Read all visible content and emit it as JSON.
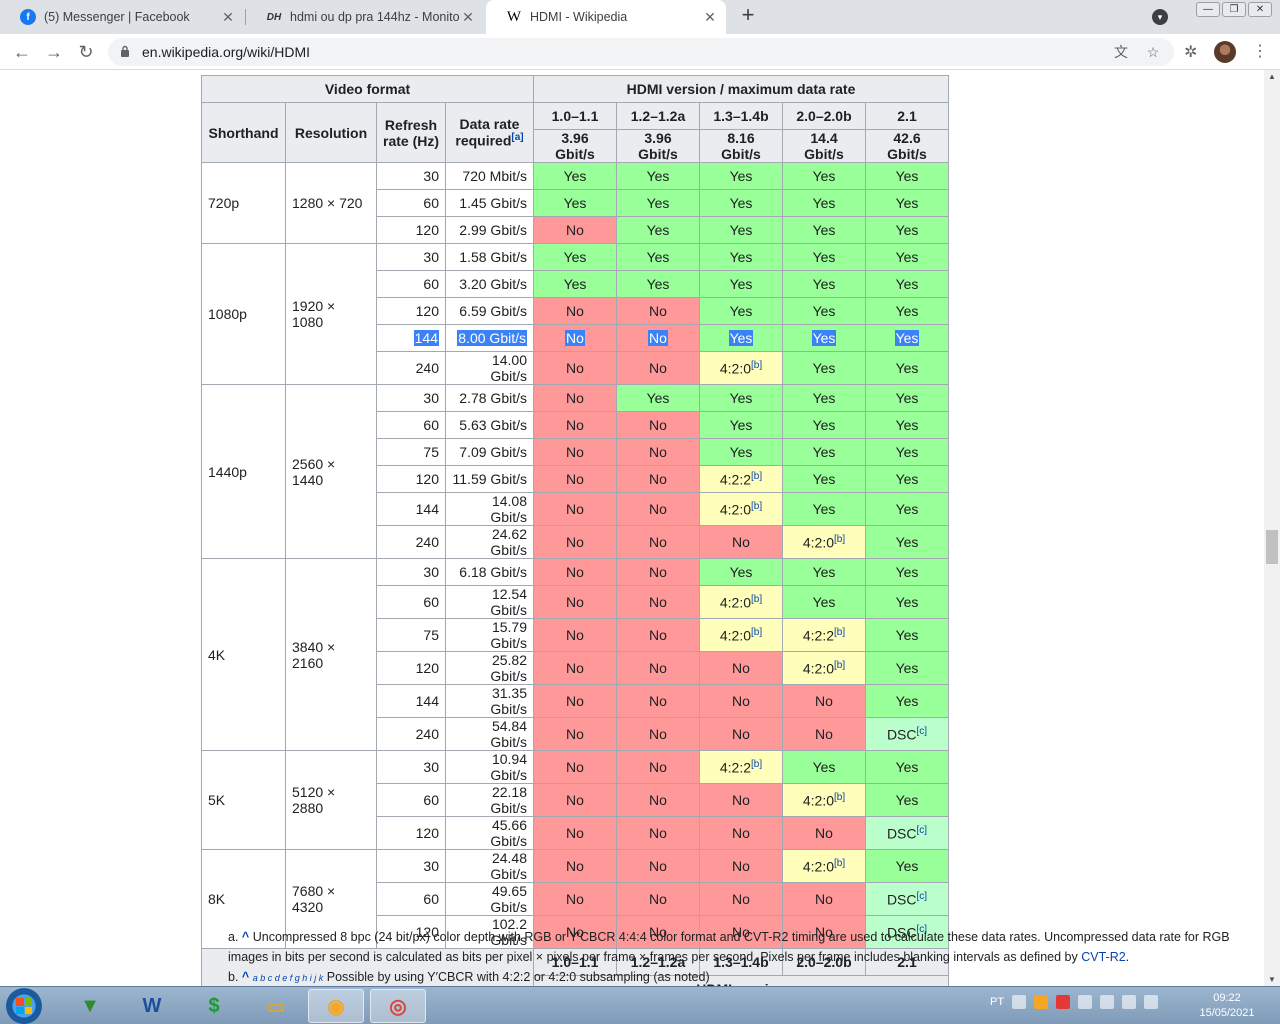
{
  "browser": {
    "tabs": [
      {
        "title": "(5) Messenger | Facebook",
        "favicon": "facebook-icon"
      },
      {
        "title": "hdmi ou dp pra 144hz - Monitores",
        "favicon": "dh-icon"
      },
      {
        "title": "HDMI - Wikipedia",
        "favicon": "wikipedia-icon"
      }
    ],
    "url": "en.wikipedia.org/wiki/HDMI"
  },
  "table": {
    "header": {
      "video_format": "Video format",
      "hdmi_version_rate": "HDMI version / maximum data rate",
      "shorthand": "Shorthand",
      "resolution": "Resolution",
      "refresh_rate": "Refresh rate (Hz)",
      "data_rate": "Data rate required",
      "data_rate_note": "[a]",
      "versions": [
        "1.0–1.1",
        "1.2–1.2a",
        "1.3–1.4b",
        "2.0–2.0b",
        "2.1"
      ],
      "max_rates": [
        "3.96 Gbit/s",
        "3.96 Gbit/s",
        "8.16 Gbit/s",
        "14.4 Gbit/s",
        "42.6 Gbit/s"
      ]
    },
    "groups": [
      {
        "shorthand": "720p",
        "resolution": "1280 × 720",
        "rows": [
          {
            "hz": "30",
            "rate": "720 Mbit/s",
            "cells": [
              "Yes",
              "Yes",
              "Yes",
              "Yes",
              "Yes"
            ]
          },
          {
            "hz": "60",
            "rate": "1.45 Gbit/s",
            "cells": [
              "Yes",
              "Yes",
              "Yes",
              "Yes",
              "Yes"
            ]
          },
          {
            "hz": "120",
            "rate": "2.99 Gbit/s",
            "cells": [
              "No",
              "Yes",
              "Yes",
              "Yes",
              "Yes"
            ]
          }
        ]
      },
      {
        "shorthand": "1080p",
        "resolution": "1920 × 1080",
        "rows": [
          {
            "hz": "30",
            "rate": "1.58 Gbit/s",
            "cells": [
              "Yes",
              "Yes",
              "Yes",
              "Yes",
              "Yes"
            ]
          },
          {
            "hz": "60",
            "rate": "3.20 Gbit/s",
            "cells": [
              "Yes",
              "Yes",
              "Yes",
              "Yes",
              "Yes"
            ]
          },
          {
            "hz": "120",
            "rate": "6.59 Gbit/s",
            "cells": [
              "No",
              "No",
              "Yes",
              "Yes",
              "Yes"
            ]
          },
          {
            "hz": "144",
            "rate": "8.00 Gbit/s",
            "cells": [
              "No",
              "No",
              "Yes",
              "Yes",
              "Yes"
            ],
            "selected": true
          },
          {
            "hz": "240",
            "rate": "14.00 Gbit/s",
            "cells": [
              "No",
              "No",
              "4:2:0",
              "Yes",
              "Yes"
            ]
          }
        ]
      },
      {
        "shorthand": "1440p",
        "resolution": "2560 × 1440",
        "rows": [
          {
            "hz": "30",
            "rate": "2.78 Gbit/s",
            "cells": [
              "No",
              "Yes",
              "Yes",
              "Yes",
              "Yes"
            ]
          },
          {
            "hz": "60",
            "rate": "5.63 Gbit/s",
            "cells": [
              "No",
              "No",
              "Yes",
              "Yes",
              "Yes"
            ]
          },
          {
            "hz": "75",
            "rate": "7.09 Gbit/s",
            "cells": [
              "No",
              "No",
              "Yes",
              "Yes",
              "Yes"
            ]
          },
          {
            "hz": "120",
            "rate": "11.59 Gbit/s",
            "cells": [
              "No",
              "No",
              "4:2:2",
              "Yes",
              "Yes"
            ]
          },
          {
            "hz": "144",
            "rate": "14.08 Gbit/s",
            "cells": [
              "No",
              "No",
              "4:2:0",
              "Yes",
              "Yes"
            ]
          },
          {
            "hz": "240",
            "rate": "24.62 Gbit/s",
            "cells": [
              "No",
              "No",
              "No",
              "4:2:0",
              "Yes"
            ]
          }
        ]
      },
      {
        "shorthand": "4K",
        "resolution": "3840 × 2160",
        "rows": [
          {
            "hz": "30",
            "rate": "6.18 Gbit/s",
            "cells": [
              "No",
              "No",
              "Yes",
              "Yes",
              "Yes"
            ]
          },
          {
            "hz": "60",
            "rate": "12.54 Gbit/s",
            "cells": [
              "No",
              "No",
              "4:2:0",
              "Yes",
              "Yes"
            ]
          },
          {
            "hz": "75",
            "rate": "15.79 Gbit/s",
            "cells": [
              "No",
              "No",
              "4:2:0",
              "4:2:2",
              "Yes"
            ]
          },
          {
            "hz": "120",
            "rate": "25.82 Gbit/s",
            "cells": [
              "No",
              "No",
              "No",
              "4:2:0",
              "Yes"
            ]
          },
          {
            "hz": "144",
            "rate": "31.35 Gbit/s",
            "cells": [
              "No",
              "No",
              "No",
              "No",
              "Yes"
            ]
          },
          {
            "hz": "240",
            "rate": "54.84 Gbit/s",
            "cells": [
              "No",
              "No",
              "No",
              "No",
              "DSC"
            ]
          }
        ]
      },
      {
        "shorthand": "5K",
        "resolution": "5120 × 2880",
        "rows": [
          {
            "hz": "30",
            "rate": "10.94 Gbit/s",
            "cells": [
              "No",
              "No",
              "4:2:2",
              "Yes",
              "Yes"
            ]
          },
          {
            "hz": "60",
            "rate": "22.18 Gbit/s",
            "cells": [
              "No",
              "No",
              "No",
              "4:2:0",
              "Yes"
            ]
          },
          {
            "hz": "120",
            "rate": "45.66 Gbit/s",
            "cells": [
              "No",
              "No",
              "No",
              "No",
              "DSC"
            ]
          }
        ]
      },
      {
        "shorthand": "8K",
        "resolution": "7680 × 4320",
        "rows": [
          {
            "hz": "30",
            "rate": "24.48 Gbit/s",
            "cells": [
              "No",
              "No",
              "No",
              "4:2:0",
              "Yes"
            ]
          },
          {
            "hz": "60",
            "rate": "49.65 Gbit/s",
            "cells": [
              "No",
              "No",
              "No",
              "No",
              "DSC"
            ]
          },
          {
            "hz": "120",
            "rate": "102.2 Gbit/s",
            "cells": [
              "No",
              "No",
              "No",
              "No",
              "DSC"
            ]
          }
        ]
      }
    ],
    "footer_versions": [
      "1.0–1.1",
      "1.2–1.2a",
      "1.3–1.4b",
      "2.0–2.0b",
      "2.1"
    ],
    "footer_label": "HDMI version",
    "subsampling_note": "[b]",
    "dsc_note": "[c]"
  },
  "notes": {
    "a_label": "a.",
    "a_caret": "^",
    "a_text": "Uncompressed 8 bpc (24 bit/px) color depth with RGB or Y′CBCR 4:4:4 color format and CVT-R2 timing are used to calculate these data rates. Uncompressed data rate for RGB images in bits per second is calculated as bits per pixel × pixels per frame × frames per second. Pixels per frame includes blanking intervals as defined by",
    "a_link": "CVT-R2",
    "b_label": "b.",
    "b_caret": "^",
    "b_letters": "a b c d e f g h i j k",
    "b_text": "Possible by using Y′CBCR with 4:2:2 or 4:2:0 subsampling (as noted)"
  },
  "taskbar": {
    "lang": "PT",
    "time": "09:22",
    "date": "15/05/2021"
  },
  "colors": {
    "yes": "#99ff99",
    "no": "#ff9999",
    "partial": "#ffffbb",
    "dsc": "#bbffcc",
    "header": "#eaecf0",
    "selection": "#1a73e8"
  }
}
